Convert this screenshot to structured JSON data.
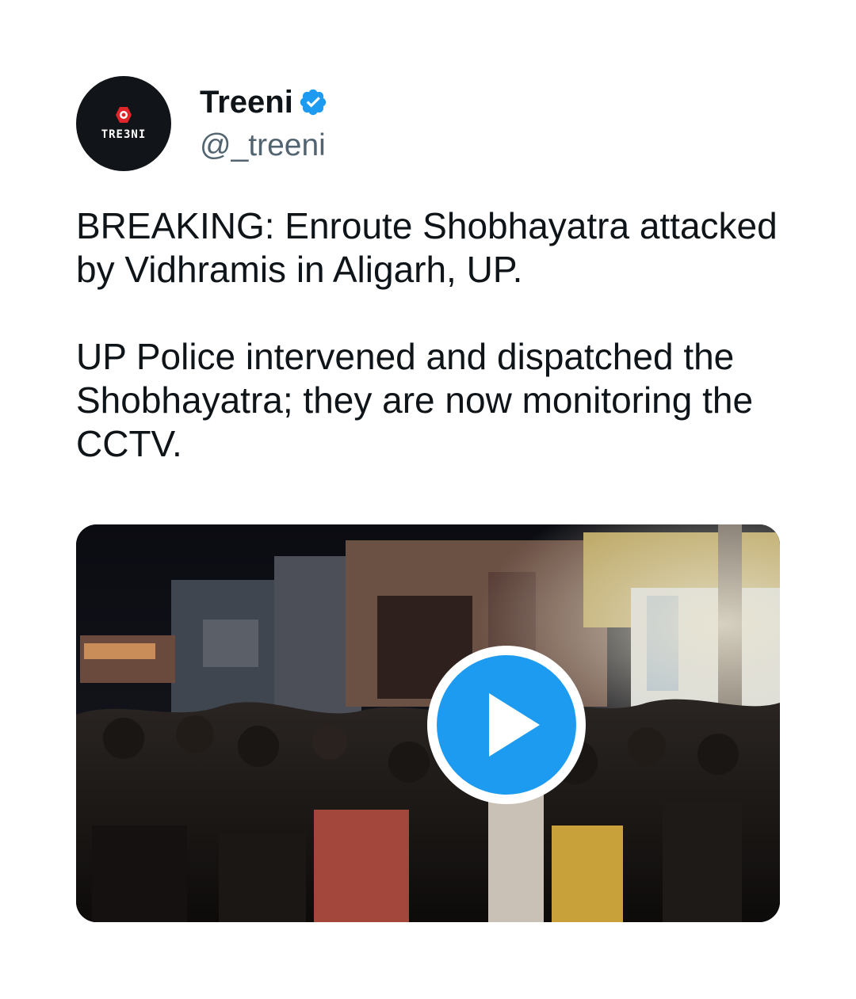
{
  "author": {
    "display_name": "Treeni",
    "handle": "@_treeni",
    "verified": true,
    "avatar_text": "TRE3NI",
    "avatar_icon": "treeni-logo-icon",
    "verified_icon": "verified-badge-icon"
  },
  "tweet": {
    "paragraphs": [
      "BREAKING: Enroute Shobhayatra attacked by Vidhramis in Aligarh, UP.",
      "UP Police intervened and dispatched the Shobhayatra; they are now monitoring the CCTV."
    ]
  },
  "media": {
    "type": "video",
    "play_icon": "play-icon"
  },
  "colors": {
    "text": "#0f1419",
    "secondary": "#536471",
    "accent": "#1d9bf0",
    "avatar_bg": "#111418",
    "logo_red": "#e0262a"
  }
}
